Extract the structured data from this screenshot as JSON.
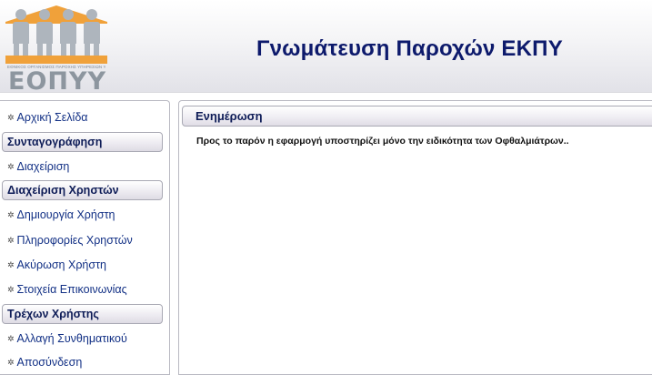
{
  "header": {
    "app_title": "Γνωμάτευση Παροχών ΕΚΠΥ",
    "logo": {
      "brand": "ΕΟΠΥΥ",
      "tagline": "ΕΘΝΙΚΟΣ ΟΡΓΑΝΙΣΜΟΣ ΠΑΡΟΧΗΣ ΥΠΗΡΕΣΙΩΝ ΥΓΕΙΑΣ",
      "accent_color": "#f0a13a",
      "figure_color": "#aeb5bd"
    }
  },
  "sidebar": {
    "home": "Αρχική Σελίδα",
    "sections": [
      {
        "title": "Συνταγογράφηση",
        "items": [
          "Διαχείριση"
        ]
      },
      {
        "title": "Διαχείριση Χρηστών",
        "items": [
          "Δημιουργία Χρήστη",
          "Πληροφορίες Χρηστών",
          "Ακύρωση Χρήστη",
          "Στοιχεία Επικοινωνίας"
        ]
      },
      {
        "title": "Τρέχων Χρήστης",
        "items": [
          "Αλλαγή Συνθηματικού",
          "Αποσύνδεση"
        ]
      }
    ],
    "bullet_icon": "gear-bullet-icon"
  },
  "main": {
    "panel_title": "Ενημέρωση",
    "message": "Προς το παρόν η εφαρμογή υποστηρίζει μόνο την ειδικότητα των Οφθαλμιάτρων.."
  }
}
